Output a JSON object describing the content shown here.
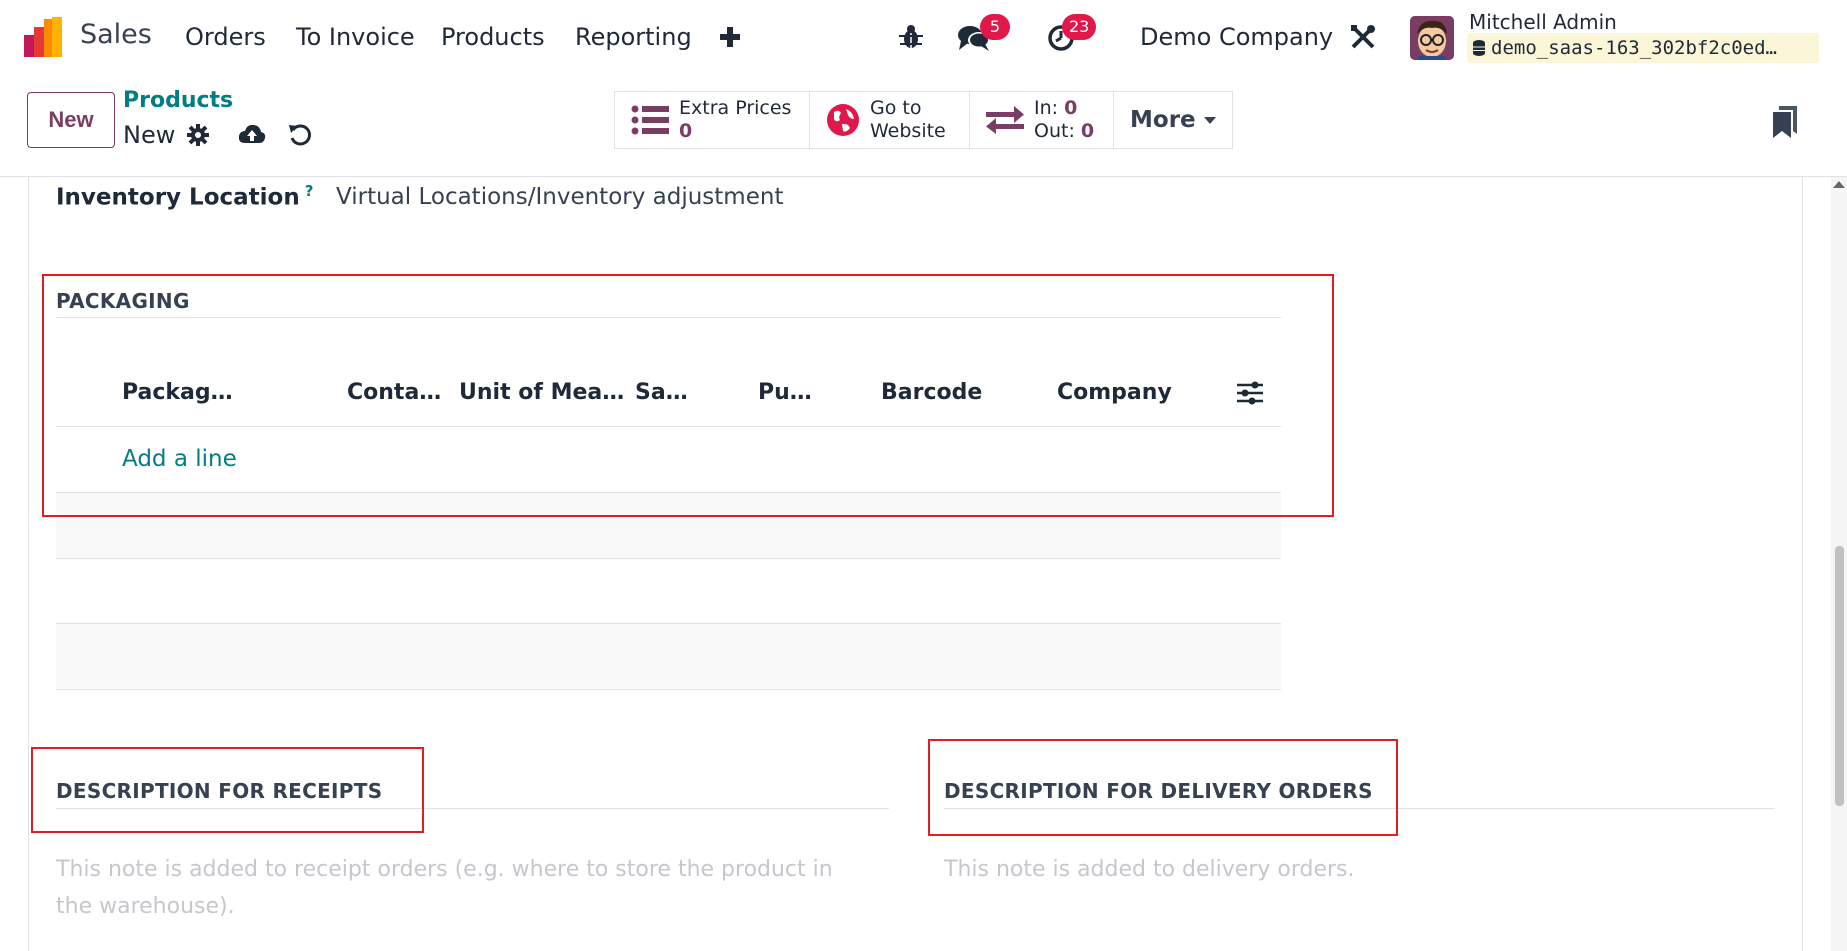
{
  "navbar": {
    "app_name": "Sales",
    "menu": [
      "Orders",
      "To Invoice",
      "Products",
      "Reporting"
    ],
    "add_icon": "plus-icon",
    "debug_icon": "bug-icon",
    "messages_count": "5",
    "activities_count": "23",
    "company": "Demo Company",
    "settings_icon": "tools-icon",
    "user_name": "Mitchell Admin",
    "database": "demo_saas-163_302bf2c0ed…"
  },
  "control_panel": {
    "new_label": "New",
    "breadcrumb": "Products",
    "record_name": "New",
    "stat_buttons": {
      "extra_prices_label": "Extra Prices",
      "extra_prices_value": "0",
      "website_line1": "Go to",
      "website_line2": "Website",
      "in_label": "In:",
      "in_value": "0",
      "out_label": "Out:",
      "out_value": "0",
      "more_label": "More"
    }
  },
  "form": {
    "inventory_location_label": "Inventory Location",
    "inventory_location_help": "?",
    "inventory_location_value": "Virtual Locations/Inventory adjustment",
    "packaging": {
      "title": "PACKAGING",
      "columns": [
        "Packag…",
        "Conta…",
        "Unit of Mea…",
        "Sa…",
        "Pu…",
        "Barcode",
        "Company"
      ],
      "add_line": "Add a line"
    },
    "receipts": {
      "title": "DESCRIPTION FOR RECEIPTS",
      "placeholder_line1": "This note is added to receipt orders (e.g. where to store the product in",
      "placeholder_line2": "the warehouse)."
    },
    "delivery": {
      "title": "DESCRIPTION FOR DELIVERY ORDERS",
      "placeholder": "This note is added to delivery orders."
    }
  },
  "colors": {
    "brand": "#7a3d63",
    "link": "#017e84",
    "badge": "#e0194a",
    "highlight": "#e02020"
  }
}
